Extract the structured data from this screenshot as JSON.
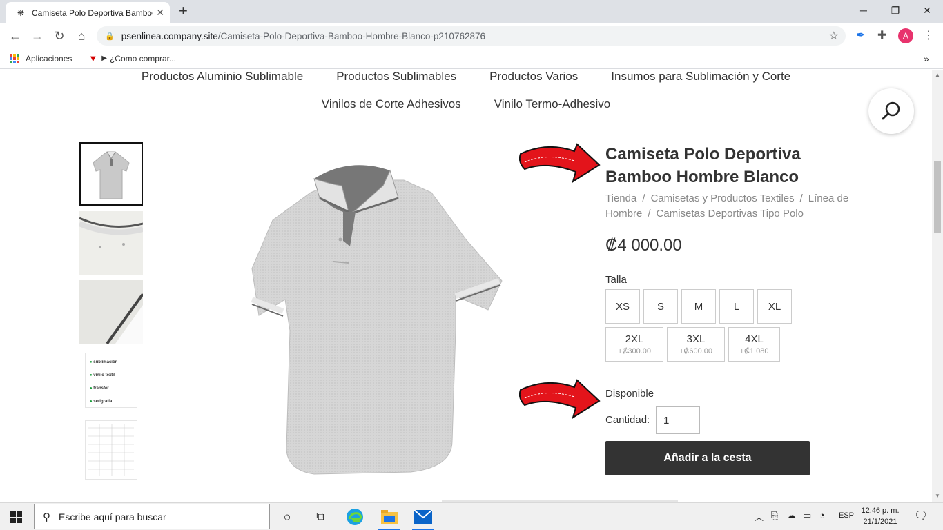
{
  "browser": {
    "tab_title": "Camiseta Polo Deportiva Bamboo Hombre Blanco",
    "new_tab": "+",
    "url_host": "psenlinea.company.site",
    "url_path": "/Camiseta-Polo-Deportiva-Bamboo-Hombre-Blanco-p210762876",
    "avatar_letter": "A",
    "bookmarks": [
      "Aplicaciones",
      "¿Como comprar..."
    ],
    "bookmarks_more": "»"
  },
  "nav": {
    "row1": [
      "Productos Aluminio Sublimable",
      "Productos Sublimables",
      "Productos Varios",
      "Insumos para Sublimación y Corte"
    ],
    "row2": [
      "Vinilos de Corte Adhesivos",
      "Vinilo Termo-Adhesivo"
    ]
  },
  "product": {
    "title": "Camiseta Polo Deportiva Bamboo Hombre Blanco",
    "breadcrumb": [
      "Tienda",
      "Camisetas y Productos Textiles",
      "Línea de Hombre",
      "Camisetas Deportivas Tipo Polo"
    ],
    "breadcrumb_sep": "/",
    "price": "₡4 000.00",
    "size_label": "Talla",
    "sizes_row1": [
      "XS",
      "S",
      "M",
      "L",
      "XL"
    ],
    "sizes_row2": [
      {
        "label": "2XL",
        "extra": "+₡300.00"
      },
      {
        "label": "3XL",
        "extra": "+₡600.00"
      },
      {
        "label": "4XL",
        "extra": "+₡1 080"
      }
    ],
    "availability": "Disponible",
    "qty_label": "Cantidad:",
    "qty_value": "1",
    "add_to_cart": "Añadir a la cesta",
    "thumb_badges": [
      "sublimación",
      "vinilo textil",
      "transfer",
      "serigrafía"
    ]
  },
  "taskbar": {
    "search_placeholder": "Escribe aquí para buscar",
    "lang": "ESP",
    "time": "12:46 p. m.",
    "date": "21/1/2021"
  },
  "colors": {
    "accent_arrow": "#e3141b",
    "cart_button": "#333333",
    "avatar": "#e8336d"
  }
}
